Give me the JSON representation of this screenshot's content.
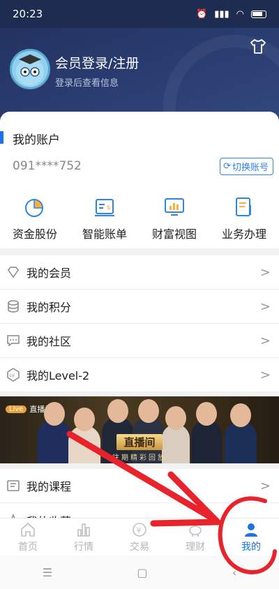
{
  "status": {
    "time": "20:23"
  },
  "header": {
    "title": "会员登录/注册",
    "subtitle": "登录后查看信息"
  },
  "account": {
    "title": "我的账户",
    "number": "091****752",
    "switch_label": "切换账号"
  },
  "quick": [
    {
      "label": "资金股份",
      "icon": "pie-chart-icon"
    },
    {
      "label": "智能账单",
      "icon": "bill-icon"
    },
    {
      "label": "财富视图",
      "icon": "monitor-chart-icon"
    },
    {
      "label": "业务办理",
      "icon": "document-edit-icon"
    }
  ],
  "menu": [
    {
      "label": "我的会员",
      "icon": "diamond-icon"
    },
    {
      "label": "我的积分",
      "icon": "coins-icon"
    },
    {
      "label": "我的社区",
      "icon": "chat-icon"
    },
    {
      "label": "我的Level-2",
      "icon": "lv-badge-icon"
    }
  ],
  "banner": {
    "tag": "直播间",
    "pill": "Live",
    "title": "直播间",
    "subtitle": "往期精彩回放"
  },
  "menu2": [
    {
      "label": "我的课程",
      "icon": "course-icon"
    },
    {
      "label": "我的收藏",
      "icon": "star-icon"
    }
  ],
  "tabs": [
    {
      "label": "首页",
      "icon": "home-icon",
      "active": false
    },
    {
      "label": "行情",
      "icon": "bar-chart-icon",
      "active": false
    },
    {
      "label": "交易",
      "icon": "yen-coin-icon",
      "active": false
    },
    {
      "label": "理财",
      "icon": "piggy-bank-icon",
      "active": false
    },
    {
      "label": "我的",
      "icon": "user-icon",
      "active": true
    }
  ],
  "colors": {
    "brand": "#1a73e8",
    "header": "#233260",
    "annotation": "#e8232b"
  }
}
